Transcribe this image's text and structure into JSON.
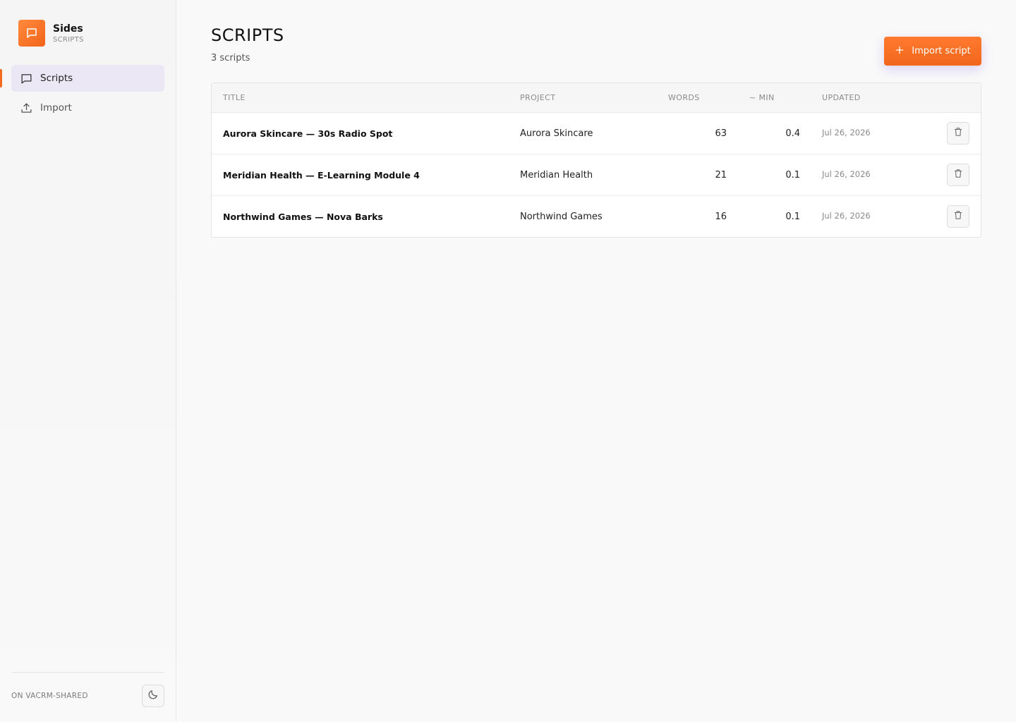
{
  "app": {
    "name": "Sides",
    "section": "SCRIPTS",
    "accent": "#f26b1f",
    "logo_icon": "message-square-icon"
  },
  "sidebar": {
    "items": [
      {
        "label": "Scripts",
        "icon": "message-square-icon",
        "active": true
      },
      {
        "label": "Import",
        "icon": "upload-icon",
        "active": false
      }
    ],
    "workspace": "ON VACRM-SHARED",
    "theme_icon": "moon-icon"
  },
  "page": {
    "title": "SCRIPTS",
    "count": "3 scripts",
    "import_label": "Import script",
    "import_icon": "plus-icon"
  },
  "table": {
    "columns": [
      "TITLE",
      "PROJECT",
      "WORDS",
      "~ MIN",
      "UPDATED"
    ],
    "rows": [
      {
        "title": "Aurora Skincare — 30s Radio Spot",
        "project": "Aurora Skincare",
        "words": "63",
        "min": "0.4",
        "updated": "Jul 26, 2026"
      },
      {
        "title": "Meridian Health — E-Learning Module 4",
        "project": "Meridian Health",
        "words": "21",
        "min": "0.1",
        "updated": "Jul 26, 2026"
      },
      {
        "title": "Northwind Games — Nova Barks",
        "project": "Northwind Games",
        "words": "16",
        "min": "0.1",
        "updated": "Jul 26, 2026"
      }
    ],
    "delete_icon": "trash-icon"
  }
}
